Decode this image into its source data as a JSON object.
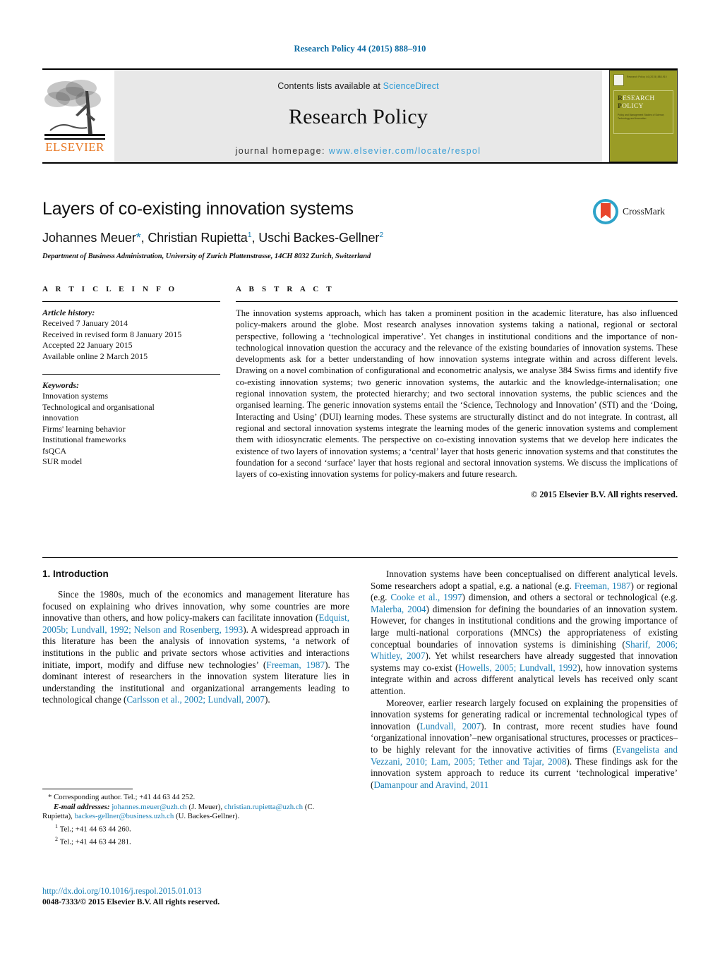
{
  "running_head": "Research Policy 44 (2015) 888–910",
  "journal_header": {
    "contents_prefix": "Contents lists available at",
    "sciencedirect": "ScienceDirect",
    "journal_title": "Research Policy",
    "homepage_label": "journal homepage:",
    "homepage_url": "www.elsevier.com/locate/respol",
    "publisher_wordmark": "ELSEVIER",
    "cover_top_text": "Research Policy 44 (2015) 888-910",
    "cover_title_line1": "RESEARCH",
    "cover_title_line2": "POLICY",
    "cover_subtitle": "Policy and Management Studies of Science, Technology and Innovation",
    "link_color": "#2b9ad6",
    "elsevier_orange": "#E87722",
    "cover_olive": "#9a9c26"
  },
  "title_block": {
    "title": "Layers of co-existing innovation systems",
    "authors": [
      {
        "name": "Johannes Meuer",
        "marker": "*"
      },
      {
        "name": "Christian Rupietta",
        "marker": "1"
      },
      {
        "name": "Uschi Backes-Gellner",
        "marker": "2"
      }
    ],
    "affiliation": "Department of Business Administration, University of Zurich Plattenstrasse, 14CH 8032 Zurich, Switzerland",
    "crossmark_label": "CrossMark"
  },
  "article_info": {
    "section_title": "A R T I C L E   I N F O",
    "history_label": "Article history:",
    "history": [
      "Received 7 January 2014",
      "Received in revised form 8 January 2015",
      "Accepted 22 January 2015",
      "Available online 2 March 2015"
    ],
    "keywords_label": "Keywords:",
    "keywords": [
      "Innovation systems",
      "Technological and organisational",
      "innovation",
      "Firms' learning behavior",
      "Institutional frameworks",
      "fsQCA",
      "SUR model"
    ]
  },
  "abstract": {
    "section_title": "A B S T R A C T",
    "text": "The innovation systems approach, which has taken a prominent position in the academic literature, has also influenced policy-makers around the globe. Most research analyses innovation systems taking a national, regional or sectoral perspective, following a ‘technological imperative’. Yet changes in institutional conditions and the importance of non-technological innovation question the accuracy and the relevance of the existing boundaries of innovation systems. These developments ask for a better understanding of how innovation systems integrate within and across different levels. Drawing on a novel combination of configurational and econometric analysis, we analyse 384 Swiss firms and identify five co-existing innovation systems; two generic innovation systems, the autarkic and the knowledge-internalisation; one regional innovation system, the protected hierarchy; and two sectoral innovation systems, the public sciences and the organised learning. The generic innovation systems entail the ‘Science, Technology and Innovation’ (STI) and the ‘Doing, Interacting and Using’ (DUI) learning modes. These systems are structurally distinct and do not integrate. In contrast, all regional and sectoral innovation systems integrate the learning modes of the generic innovation systems and complement them with idiosyncratic elements. The perspective on co-existing innovation systems that we develop here indicates the existence of two layers of innovation systems; a ‘central’ layer that hosts generic innovation systems and that constitutes the foundation for a second ‘surface’ layer that hosts regional and sectoral innovation systems. We discuss the implications of layers of co-existing innovation systems for policy-makers and future research.",
    "copyright": "© 2015 Elsevier B.V. All rights reserved."
  },
  "body": {
    "section_number_title": "1.  Introduction",
    "left_paragraph_1": {
      "part1": "Since the 1980s, much of the economics and management literature has focused on explaining who drives innovation, why some countries are more innovative than others, and how policy-makers can facilitate innovation (",
      "cite1": "Edquist, 2005b; Lundvall, 1992; Nelson and Rosenberg, 1993",
      "part2": "). A widespread approach in this literature has been the analysis of innovation systems, ‘a network of institutions in the public and private sectors whose activities and interactions initiate, import, modify and diffuse new technologies’ (",
      "cite2": "Freeman, 1987",
      "part3": "). The dominant interest of researchers in the innovation system literature lies in understanding the institutional and organizational arrangements leading to technological change (",
      "cite3": "Carlsson et al., 2002; Lundvall, 2007",
      "part4": ")."
    },
    "right_paragraph_1": {
      "part1": "Innovation systems have been conceptualised on different analytical levels. Some researchers adopt a spatial, e.g. a national (e.g. ",
      "cite1": "Freeman, 1987",
      "part2": ") or regional (e.g. ",
      "cite2": "Cooke et al., 1997",
      "part3": ") dimension, and others a sectoral or technological (e.g. ",
      "cite3": "Malerba, 2004",
      "part4": ") dimension for defining the boundaries of an innovation system. However, for changes in institutional conditions and the growing importance of large multi-national corporations (MNCs) the appropriateness of existing conceptual boundaries of innovation systems is diminishing (",
      "cite4": "Sharif, 2006; Whitley, 2007",
      "part5": "). Yet whilst researchers have already suggested that innovation systems may co-exist (",
      "cite5": "Howells, 2005; Lundvall, 1992",
      "part6": "), how innovation systems integrate within and across different analytical levels has received only scant attention."
    },
    "right_paragraph_2": {
      "part1": "Moreover, earlier research largely focused on explaining the propensities of innovation systems for generating radical or incremental technological types of innovation (",
      "cite1": "Lundvall, 2007",
      "part2": "). In contrast, more recent studies have found ‘organizational innovation’–new organisational structures, processes or practices–to be highly relevant for the innovative activities of firms (",
      "cite2": "Evangelista and Vezzani, 2010; Lam, 2005; Tether and Tajar, 2008",
      "part3": "). These findings ask for the innovation system approach to reduce its current ‘technological imperative’ (",
      "cite3": "Damanpour and Aravind, 2011"
    }
  },
  "footnotes": {
    "corresponding": "Corresponding author. Tel.; +41 44 63 44 252.",
    "email_label": "E-mail addresses:",
    "email1": "johannes.meuer@uzh.ch",
    "email1_owner": "(J. Meuer),",
    "email2": "christian.rupietta@uzh.ch",
    "email2_owner": "(C. Rupietta),",
    "email3": "backes-gellner@business.uzh.ch",
    "email3_owner": "(U. Backes-Gellner).",
    "note1_marker": "1",
    "note1": "Tel.; +41 44 63 44 260.",
    "note2_marker": "2",
    "note2": "Tel.; +41 44 63 44 281."
  },
  "doi_block": {
    "doi": "http://dx.doi.org/10.1016/j.respol.2015.01.013",
    "issn": "0048-7333/© 2015 Elsevier B.V. All rights reserved."
  }
}
